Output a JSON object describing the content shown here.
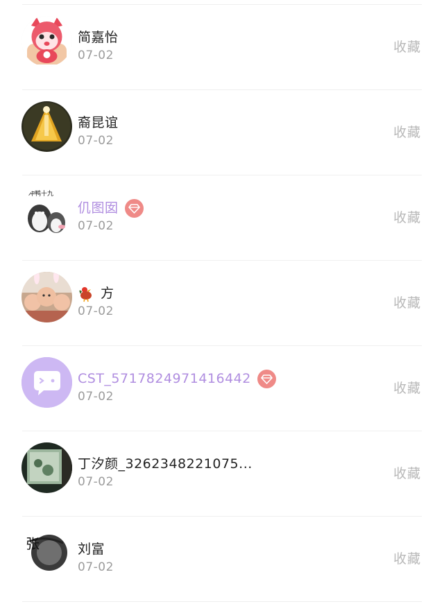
{
  "action_label": "收藏",
  "rows": [
    {
      "name": "简嘉怡",
      "date": "07-02",
      "avatar": "pink-cartoon-character-avatar",
      "vip": false
    },
    {
      "name": "裔昆谊",
      "date": "07-02",
      "avatar": "glowing-lantern-avatar",
      "vip": false
    },
    {
      "name": "仉图囡",
      "date": "07-02",
      "avatar": "penguin-sticker-avatar",
      "sticker_text": "冲鸭十九",
      "vip": true
    },
    {
      "name": "方",
      "date": "07-02",
      "avatar": "bunny-ear-selfie-avatar",
      "name_prefix_icon": "rooster-emoji",
      "vip": false
    },
    {
      "name": "CST_5717824971416442",
      "date": "07-02",
      "avatar": "chat-bubble-avatar",
      "vip": true
    },
    {
      "name": "丁汐颜_3262348221075...",
      "date": "07-02",
      "avatar": "painting-photo-avatar",
      "vip": false
    },
    {
      "name": "刘富",
      "date": "07-02",
      "avatar": "ink-calligraphy-avatar",
      "avatar_text": "张",
      "vip": false
    }
  ],
  "colors": {
    "vip_name": "#b08ee0",
    "vip_badge": "#ef8a87",
    "chat_avatar_bg": "#cdb8f3"
  }
}
